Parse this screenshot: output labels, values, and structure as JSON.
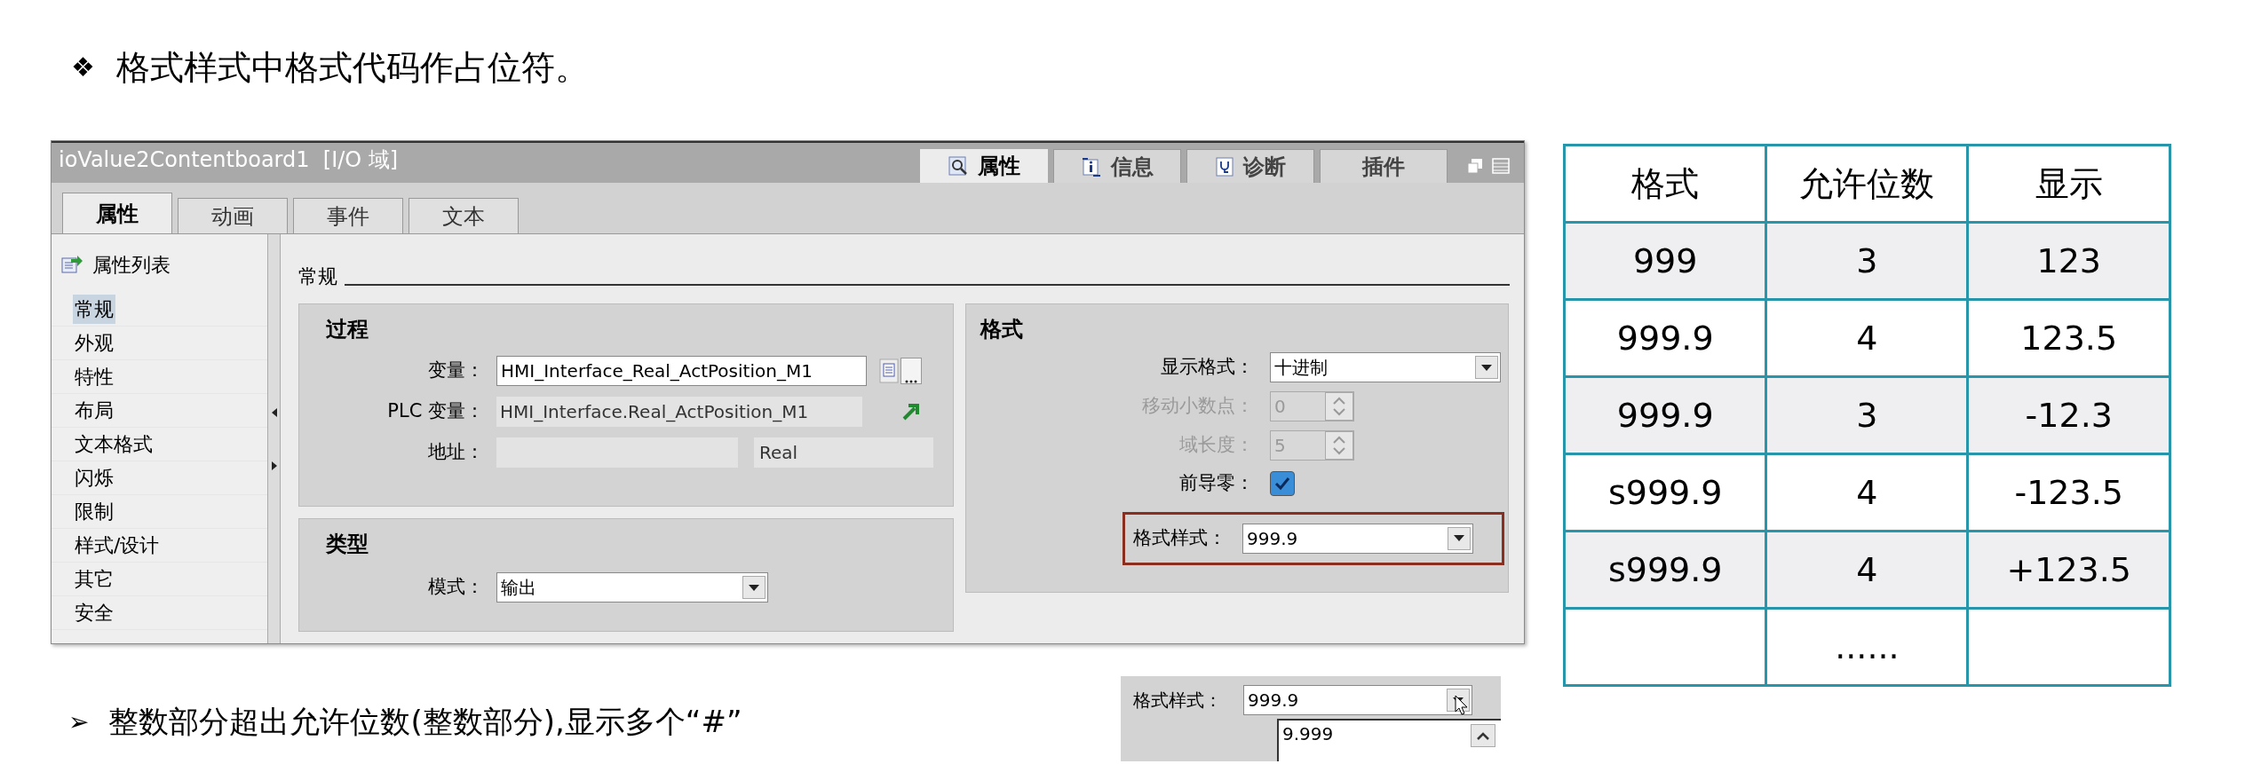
{
  "heading": {
    "bullet": "❖",
    "text": "格式样式中格式代码作占位符。"
  },
  "inspector": {
    "title": "ioValue2Contentboard1  [I/O 域]",
    "top_tabs": [
      {
        "label": "属性",
        "kind": "properties",
        "selected": true
      },
      {
        "label": "信息",
        "kind": "info",
        "selected": false
      },
      {
        "label": "诊断",
        "kind": "diagnostics",
        "selected": false
      },
      {
        "label": "插件",
        "kind": "addins",
        "selected": false
      }
    ],
    "tabs": [
      {
        "label": "属性",
        "selected": true
      },
      {
        "label": "动画",
        "selected": false
      },
      {
        "label": "事件",
        "selected": false
      },
      {
        "label": "文本",
        "selected": false
      }
    ],
    "sidebar": {
      "header": "属性列表",
      "items": [
        {
          "label": "常规",
          "selected": true
        },
        {
          "label": "外观",
          "selected": false
        },
        {
          "label": "特性",
          "selected": false
        },
        {
          "label": "布局",
          "selected": false
        },
        {
          "label": "文本格式",
          "selected": false
        },
        {
          "label": "闪烁",
          "selected": false
        },
        {
          "label": "限制",
          "selected": false
        },
        {
          "label": "样式/设计",
          "selected": false
        },
        {
          "label": "其它",
          "selected": false
        },
        {
          "label": "安全",
          "selected": false
        }
      ]
    },
    "section_title": "常规",
    "process": {
      "title": "过程",
      "tag": {
        "label": "变量：",
        "value": "HMI_Interface_Real_ActPosition_M1"
      },
      "plc_tag": {
        "label": "PLC 变量：",
        "value": "HMI_Interface.Real_ActPosition_M1"
      },
      "address": {
        "label": "地址：",
        "data_type": "Real"
      }
    },
    "type": {
      "title": "类型",
      "mode": {
        "label": "模式：",
        "value": "输出"
      }
    },
    "format": {
      "title": "格式",
      "display_format": {
        "label": "显示格式：",
        "value": "十进制"
      },
      "decimal_shift": {
        "label": "移动小数点：",
        "value": "0",
        "disabled": true
      },
      "field_length": {
        "label": "域长度：",
        "value": "5",
        "disabled": true
      },
      "leading_zeros": {
        "label": "前导零：",
        "checked": true
      },
      "format_pattern": {
        "label": "格式样式：",
        "value": "999.9",
        "highlighted": true
      }
    }
  },
  "table": {
    "columns": [
      "格式",
      "允许位数",
      "显示"
    ],
    "rows": [
      [
        "999",
        "3",
        "123"
      ],
      [
        "999.9",
        "4",
        "123.5"
      ],
      [
        "999.9",
        "3",
        "-12.3"
      ],
      [
        "s999.9",
        "4",
        "-123.5"
      ],
      [
        "s999.9",
        "4",
        "+123.5"
      ],
      [
        "",
        "......",
        ""
      ]
    ]
  },
  "note": {
    "bullet": "➢",
    "text": "整数部分超出允许位数(整数部分),显示多个“#”"
  },
  "dropdown_example": {
    "label": "格式样式：",
    "value": "999.9",
    "options": [
      "9.999"
    ]
  }
}
